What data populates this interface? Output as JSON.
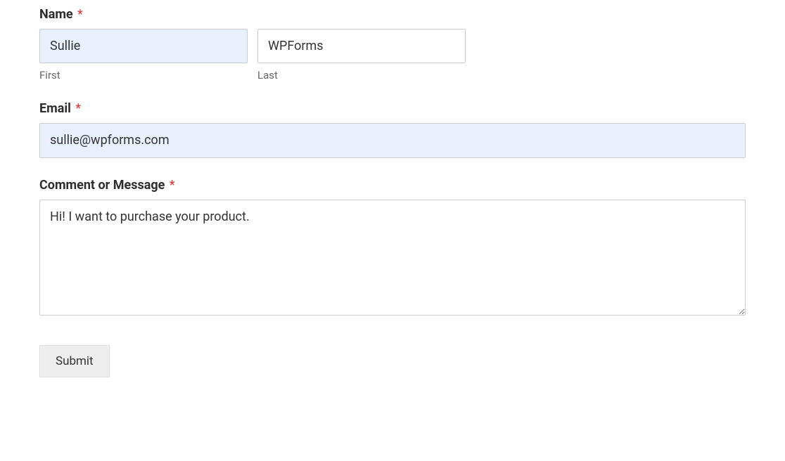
{
  "form": {
    "name": {
      "label": "Name",
      "required_marker": "*",
      "first": {
        "value": "Sullie",
        "sub_label": "First"
      },
      "last": {
        "value": "WPForms",
        "sub_label": "Last"
      }
    },
    "email": {
      "label": "Email",
      "required_marker": "*",
      "value": "sullie@wpforms.com"
    },
    "message": {
      "label": "Comment or Message",
      "required_marker": "*",
      "value": "Hi! I want to purchase your product."
    },
    "submit": {
      "label": "Submit"
    }
  }
}
